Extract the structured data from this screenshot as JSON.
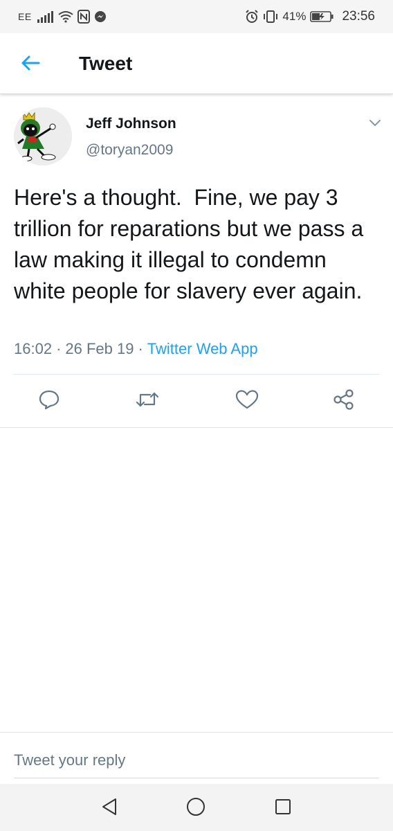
{
  "status_bar": {
    "carrier": "EE",
    "battery_percent": "41%",
    "time": "23:56",
    "icons": [
      "signal-icon",
      "wifi-icon",
      "nfc-icon",
      "messenger-icon",
      "alarm-icon",
      "vibrate-icon",
      "battery-icon"
    ]
  },
  "header": {
    "title": "Tweet",
    "back_icon": "back-arrow-icon"
  },
  "tweet": {
    "author_name": "Jeff Johnson",
    "author_handle": "@toryan2009",
    "text": "Here's a thought.  Fine, we pay 3 trillion for reparations but we pass a law making it illegal to condemn white people for slavery ever again.",
    "time": "16:02",
    "date": "26 Feb 19",
    "source": "Twitter Web App",
    "separator": "·"
  },
  "actions": {
    "icons": [
      "reply-icon",
      "retweet-icon",
      "like-icon",
      "share-icon"
    ]
  },
  "reply": {
    "placeholder": "Tweet your reply"
  },
  "nav_bar": {
    "icons": [
      "nav-back-icon",
      "nav-home-icon",
      "nav-recents-icon"
    ]
  },
  "colors": {
    "accent": "#1da1f2",
    "text_primary": "#14171a",
    "text_secondary": "#657786",
    "divider": "#e1e8ed"
  }
}
